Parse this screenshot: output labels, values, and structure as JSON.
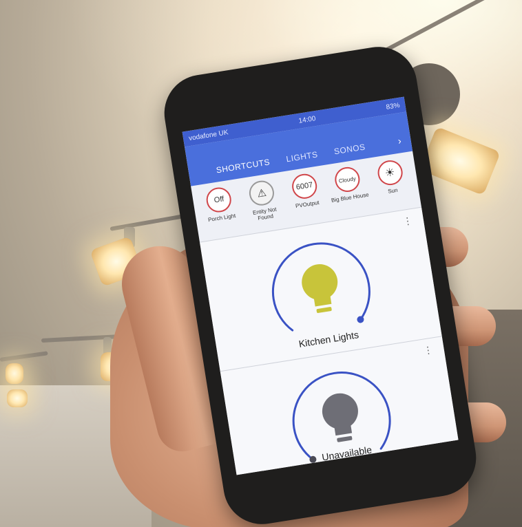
{
  "status_bar": {
    "carrier": "vodafone UK",
    "time": "14:00",
    "battery": "83%"
  },
  "app_bar": {
    "tabs": [
      "SHORTCUTS",
      "LIGHTS",
      "SONOS"
    ],
    "more_icon": "chevron-right-icon"
  },
  "shortcuts": [
    {
      "badge": "Off",
      "label": "Porch Light"
    },
    {
      "badge": "⚠",
      "label": "Entity Not Found"
    },
    {
      "badge": "6007",
      "label": "PVOutput"
    },
    {
      "badge": "Cloudy",
      "label": "Big Blue House"
    },
    {
      "badge": "☀",
      "label": "Sun"
    }
  ],
  "cards": [
    {
      "title": "Kitchen Lights",
      "state": "on",
      "color": "#c8c43a"
    },
    {
      "title": "Unavailable",
      "state": "unavailable",
      "color": "#6e6e76"
    }
  ],
  "colors": {
    "accent": "#4a6fdc",
    "dial": "#3a52c4",
    "badge_border": "#d0464a"
  }
}
